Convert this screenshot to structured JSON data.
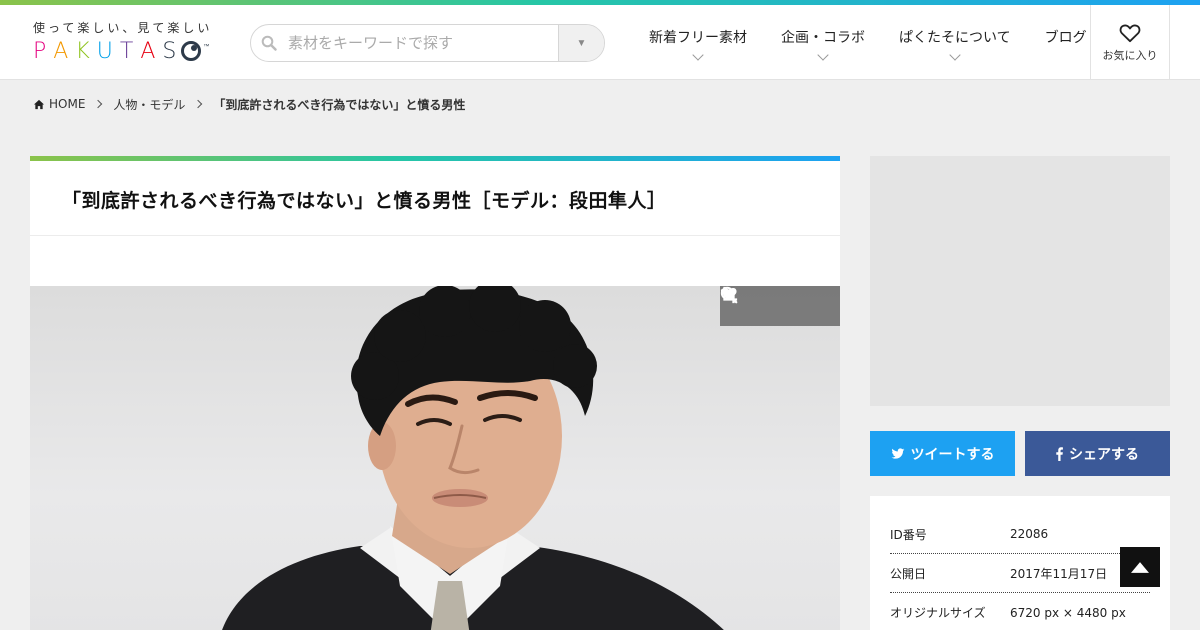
{
  "brand": {
    "tagline": "使って楽しい、見て楽しい",
    "letters": [
      "P",
      "A",
      "K",
      "U",
      "T",
      "A",
      "S"
    ],
    "tm": "™",
    "letter_colors": [
      "#e4007f",
      "#f39800",
      "#8fc31f",
      "#00a0e9",
      "#6a3f98",
      "#e60012"
    ]
  },
  "search": {
    "placeholder": "素材をキーワードで探す"
  },
  "nav": {
    "items": [
      {
        "label": "新着フリー素材"
      },
      {
        "label": "企画・コラボ"
      },
      {
        "label": "ぱくたそについて"
      },
      {
        "label": "ブログ"
      }
    ],
    "favorites_label": "お気に入り"
  },
  "breadcrumb": {
    "home": "HOME",
    "category": "人物・モデル",
    "current": "「到底許されるべき行為ではない」と憤る男性"
  },
  "article": {
    "title": "「到底許されるべき行為ではない」と憤る男性［モデル：段田隼人］"
  },
  "share": {
    "twitter": "ツイートする",
    "facebook": "シェアする"
  },
  "info": {
    "rows": [
      {
        "label": "ID番号",
        "value": "22086"
      },
      {
        "label": "公開日",
        "value": "2017年11月17日"
      },
      {
        "label": "オリジナルサイズ",
        "value": "6720 px × 4480 px"
      }
    ]
  },
  "colors": {
    "accent_green": "#8bc34a",
    "accent_blue": "#1da1f2",
    "facebook": "#3b5998"
  }
}
